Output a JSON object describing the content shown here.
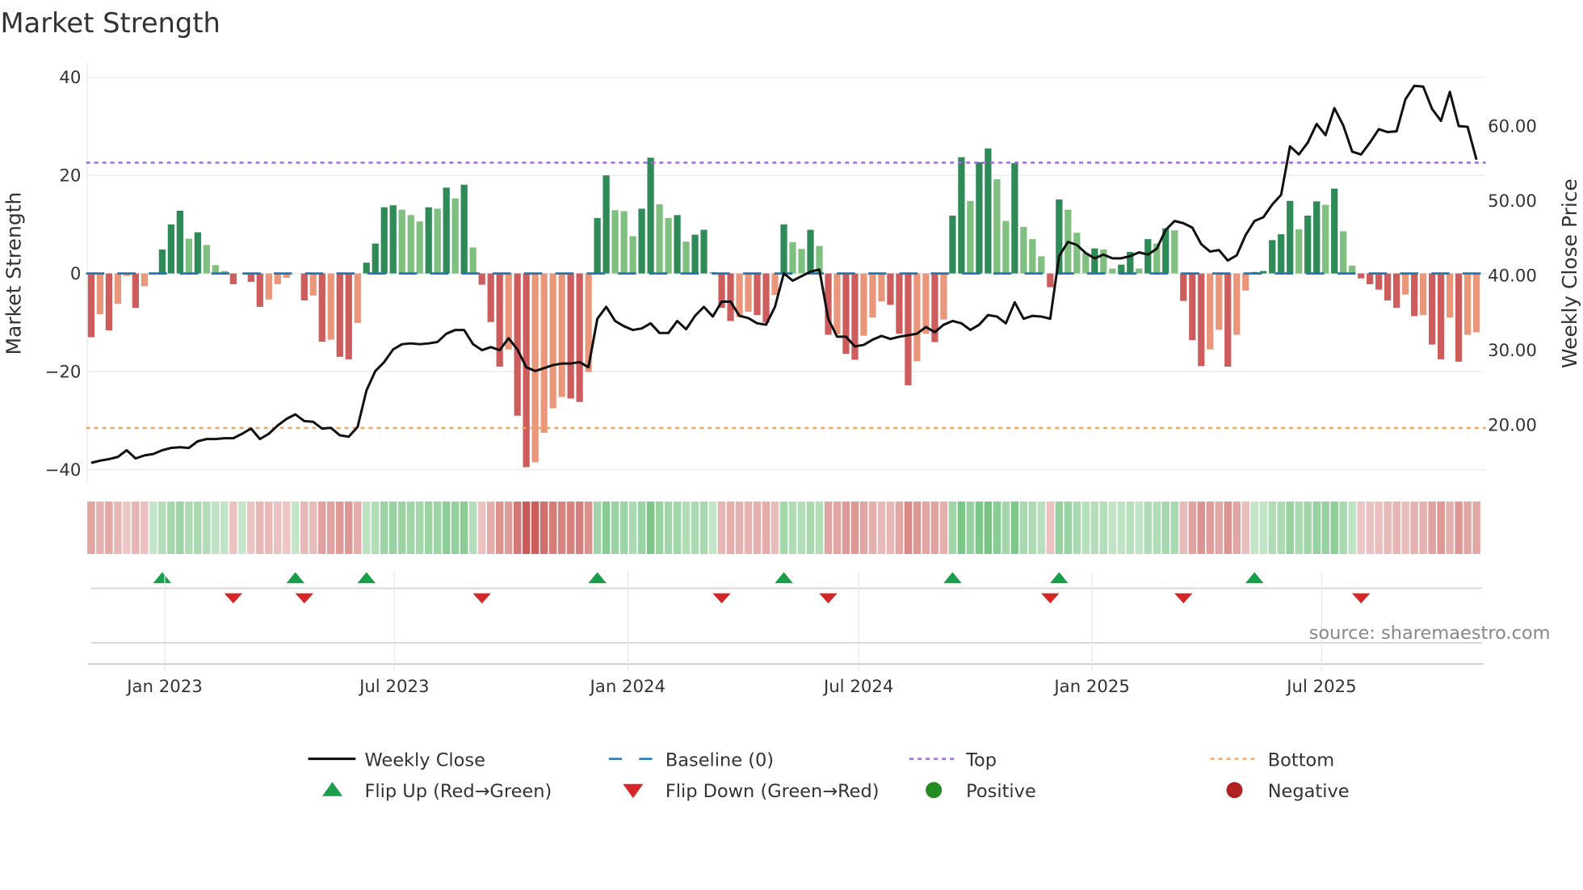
{
  "chart_data": {
    "type": "bar",
    "title": "Market Strength",
    "ylabel": "Market Strength",
    "y2label": "Weekly Close Price",
    "ylim": [
      -43,
      43
    ],
    "y2lim": [
      12.3,
      68.5
    ],
    "yticks": [
      40,
      20,
      0,
      -20,
      -40
    ],
    "yticklabels": [
      "40",
      "20",
      "0",
      "−20",
      "−40"
    ],
    "y2ticks": [
      60,
      50,
      40,
      30,
      20
    ],
    "y2ticklabels": [
      "60.00",
      "50.00",
      "40.00",
      "30.00",
      "20.00"
    ],
    "start_date": "2022-11-04",
    "frequency": "weekly",
    "xticks": [
      {
        "date": "2023-01-01",
        "label": "Jan 2023"
      },
      {
        "date": "2023-07-01",
        "label": "Jul 2023"
      },
      {
        "date": "2024-01-01",
        "label": "Jan 2024"
      },
      {
        "date": "2024-07-01",
        "label": "Jul 2024"
      },
      {
        "date": "2025-01-01",
        "label": "Jan 2025"
      },
      {
        "date": "2025-07-01",
        "label": "Jul 2025"
      }
    ],
    "top_level": 22.6,
    "bottom_level": -31.5,
    "baseline": 0,
    "grid": true,
    "legend_placement": "bottom",
    "strength": [
      -13,
      -8.3,
      -11.6,
      -6.2,
      -0.5,
      -7,
      -2.6,
      0,
      4.9,
      10,
      12.8,
      7.1,
      8.4,
      5.8,
      1.7,
      0.5,
      -2.2,
      0,
      -1.7,
      -6.8,
      -5.3,
      -2.2,
      -0.9,
      0,
      -5.5,
      -4.5,
      -13.9,
      -13.5,
      -17,
      -17.5,
      -10.1,
      2.2,
      6.1,
      13.5,
      13.9,
      13.0,
      11.9,
      10.6,
      13.5,
      13.2,
      17.5,
      15.3,
      18.1,
      5.3,
      -2.3,
      -9.9,
      -19,
      -15.5,
      -29,
      -39.5,
      -38.5,
      -32.5,
      -27.5,
      -25.2,
      -25.5,
      -26.2,
      -20.1,
      11.3,
      20,
      12.9,
      12.7,
      7.6,
      13.2,
      23.6,
      14.1,
      11.3,
      11.9,
      6.5,
      7.9,
      8.9,
      0.3,
      -7,
      -9.7,
      -8.9,
      -7.8,
      -8.5,
      -10,
      -4.4,
      10,
      6.4,
      5.0,
      8.9,
      5.6,
      -12.5,
      -12.4,
      -16.4,
      -17.6,
      -12.7,
      -9.0,
      -5.7,
      -6.4,
      -12.3,
      -22.8,
      -17.9,
      -12.3,
      -14,
      -9.4,
      11.8,
      23.7,
      14.8,
      22.7,
      25.5,
      19.2,
      10.7,
      22.5,
      9.5,
      7.0,
      3.5,
      -2.8,
      15.1,
      13.0,
      8.3,
      4.2,
      5.1,
      4.9,
      1.0,
      1.8,
      4.4,
      1.0,
      7.0,
      6.1,
      9.2,
      8.8,
      -5.6,
      -13.6,
      -18.9,
      -15.5,
      -11.5,
      -19,
      -12.5,
      -3.5,
      0.3,
      0.5,
      6.8,
      8.0,
      14.8,
      9.0,
      11.8,
      14.7,
      14.0,
      17.3,
      8.6,
      1.6,
      -1,
      -2.2,
      -3.3,
      -5.5,
      -7,
      -4.3,
      -8.7,
      -8.5,
      -14.5,
      -17.5,
      -9,
      -18,
      -12.5,
      -12
    ],
    "weekly_close": [
      14.9,
      15.2,
      15.4,
      15.7,
      16.6,
      15.5,
      15.9,
      16.1,
      16.6,
      16.9,
      17.0,
      16.9,
      17.8,
      18.1,
      18.1,
      18.2,
      18.2,
      18.8,
      19.5,
      18.1,
      18.8,
      19.9,
      20.8,
      21.4,
      20.5,
      20.4,
      19.5,
      19.6,
      18.6,
      18.4,
      19.7,
      24.6,
      27.2,
      28.4,
      30.1,
      30.8,
      30.9,
      30.8,
      30.9,
      31.1,
      32.2,
      32.7,
      32.7,
      30.8,
      30.0,
      30.4,
      30.0,
      31.6,
      30.1,
      27.7,
      27.2,
      27.6,
      28.0,
      28.2,
      28.2,
      28.4,
      27.7,
      34.2,
      35.8,
      33.9,
      33.2,
      32.7,
      32.9,
      33.6,
      32.3,
      32.3,
      33.9,
      32.8,
      34.6,
      35.8,
      34.5,
      36.5,
      36.5,
      34.6,
      34.3,
      33.6,
      33.4,
      35.8,
      40.3,
      39.3,
      39.9,
      40.5,
      40.8,
      34.2,
      31.8,
      31.8,
      30.5,
      30.7,
      31.4,
      31.9,
      31.5,
      31.8,
      32.0,
      32.2,
      33.1,
      32.4,
      33.4,
      33.9,
      33.6,
      32.7,
      33.4,
      34.7,
      34.5,
      33.6,
      36.4,
      34.2,
      34.6,
      34.5,
      34.2,
      42.6,
      44.5,
      44.1,
      43.0,
      42.3,
      42.8,
      42.3,
      42.3,
      42.6,
      43.1,
      42.8,
      43.6,
      46.1,
      47.3,
      47.0,
      46.4,
      44.2,
      43.2,
      43.4,
      42.0,
      42.7,
      45.4,
      47.3,
      47.8,
      49.5,
      50.8,
      57.3,
      56.2,
      57.8,
      60.3,
      58.8,
      62.4,
      60.1,
      56.6,
      56.2,
      57.8,
      59.6,
      59.2,
      59.3,
      63.6,
      65.4,
      65.3,
      62.3,
      60.7,
      64.6,
      60.0,
      59.9,
      55.5
    ],
    "flip_up_week_index": [
      8,
      23,
      31,
      57,
      78,
      97,
      109,
      131
    ],
    "flip_down_week_index": [
      16,
      24,
      44,
      71,
      83,
      108,
      123,
      143
    ],
    "legend": [
      {
        "label": "Weekly Close",
        "kind": "line",
        "color": "#111111"
      },
      {
        "label": "Baseline (0)",
        "kind": "dashed",
        "color": "#1f77b4"
      },
      {
        "label": "Top",
        "kind": "dotted",
        "color": "#9b6dd6"
      },
      {
        "label": "Bottom",
        "kind": "dotted",
        "color": "#f0a868"
      },
      {
        "label": "Flip Up (Red→Green)",
        "kind": "triangle-up",
        "color": "#1a9e4a"
      },
      {
        "label": "Flip Down (Green→Red)",
        "kind": "triangle-down",
        "color": "#d62728"
      },
      {
        "label": "Positive",
        "kind": "dot",
        "color": "#228b22"
      },
      {
        "label": "Negative",
        "kind": "dot",
        "color": "#b22222"
      }
    ],
    "colors": {
      "pos_strong": "#2e8b57",
      "pos_weak": "#7fbf7f",
      "neg_strong": "#cd5c5c",
      "neg_weak": "#e9967a"
    },
    "source": "source: sharemaestro.com"
  }
}
